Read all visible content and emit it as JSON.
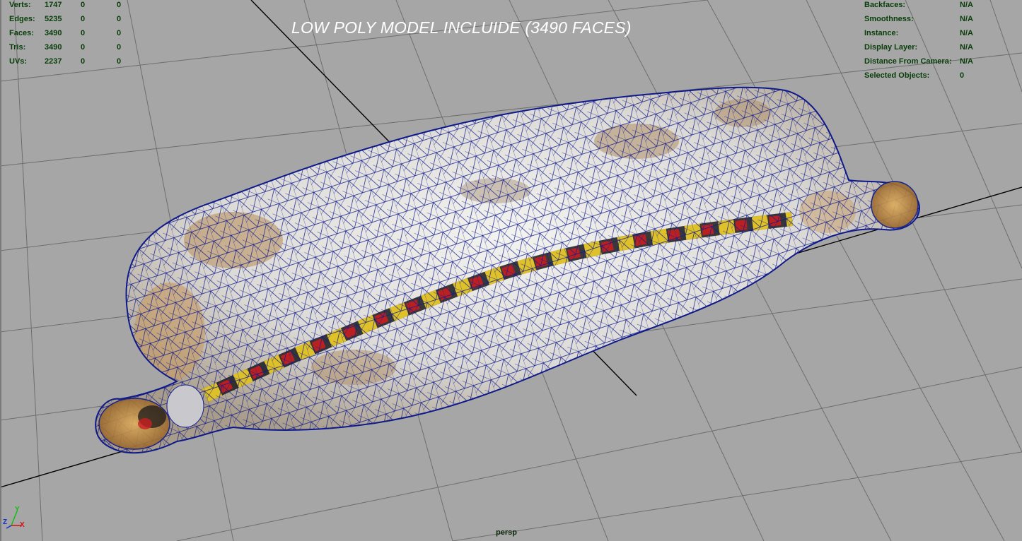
{
  "viewport": {
    "camera": "persp",
    "overlay_title": "LOW POLY MODEL INCLUIDE (3490 FACES)"
  },
  "heads_up_left": [
    {
      "label": "Verts:",
      "v1": "1747",
      "v2": "0",
      "v3": "0"
    },
    {
      "label": "Edges:",
      "v1": "5235",
      "v2": "0",
      "v3": "0"
    },
    {
      "label": "Faces:",
      "v1": "3490",
      "v2": "0",
      "v3": "0"
    },
    {
      "label": "Tris:",
      "v1": "3490",
      "v2": "0",
      "v3": "0"
    },
    {
      "label": "UVs:",
      "v1": "2237",
      "v2": "0",
      "v3": "0"
    }
  ],
  "heads_up_right": [
    {
      "label": "Backfaces:",
      "value": "N/A"
    },
    {
      "label": "Smoothness:",
      "value": "N/A"
    },
    {
      "label": "Instance:",
      "value": "N/A"
    },
    {
      "label": "Display Layer:",
      "value": "N/A"
    },
    {
      "label": "Distance From Camera:",
      "value": "N/A"
    },
    {
      "label": "Selected Objects:",
      "value": "0"
    }
  ],
  "axis_gizmo": {
    "y": "Y",
    "z": "Z",
    "x": "X"
  },
  "colors": {
    "background": "#a6a6a6",
    "grid": "#6e6e6e",
    "axis_line": "#000000",
    "hud_text": "#083d0a",
    "wireframe": "#101a8c",
    "x_axis": "#d01010",
    "y_axis": "#10c010",
    "z_axis": "#1030d0"
  }
}
